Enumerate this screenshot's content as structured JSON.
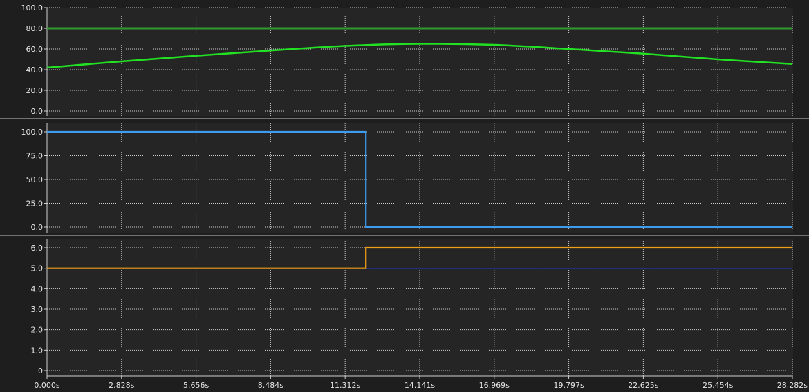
{
  "chart_data": [
    {
      "type": "line",
      "ylim": [
        0,
        100
      ],
      "yticks": [
        "100.0",
        "80.0",
        "60.0",
        "40.0",
        "20.0",
        "0.0"
      ],
      "ytick_values": [
        100,
        80,
        60,
        40,
        20,
        0
      ],
      "series": [
        {
          "color": "#2e9b2e",
          "x": [
            0,
            28.282
          ],
          "values": [
            80,
            80
          ]
        },
        {
          "color": "#22e022",
          "x": [
            0,
            2.828,
            5.656,
            8.484,
            11.312,
            14.141,
            16.969,
            19.797,
            22.625,
            25.454,
            28.282
          ],
          "values": [
            42,
            48,
            53.5,
            58.5,
            63,
            65,
            64,
            60,
            55.5,
            50,
            45.5
          ]
        }
      ]
    },
    {
      "type": "line",
      "ylim": [
        0,
        100
      ],
      "yticks": [
        "100.0",
        "75.0",
        "50.0",
        "25.0",
        "0.0"
      ],
      "ytick_values": [
        100,
        75,
        50,
        25,
        0
      ],
      "series": [
        {
          "color": "#3d9bf0",
          "x": [
            0,
            12.1,
            12.1,
            28.282
          ],
          "values": [
            100,
            100,
            0,
            0
          ]
        }
      ]
    },
    {
      "type": "line",
      "ylim": [
        0,
        6
      ],
      "yticks": [
        "6.0",
        "5.0",
        "4.0",
        "3.0",
        "2.0",
        "1.0",
        "0"
      ],
      "ytick_values": [
        6,
        5,
        4,
        3,
        2,
        1,
        0
      ],
      "series": [
        {
          "color": "#1a3cff",
          "x": [
            0,
            28.282
          ],
          "values": [
            5,
            5
          ]
        },
        {
          "color": "#f0a018",
          "x": [
            0,
            12.1,
            12.1,
            28.282
          ],
          "values": [
            5,
            5,
            6,
            6
          ]
        }
      ]
    }
  ],
  "x_axis": {
    "xlim": [
      0,
      28.282
    ],
    "tick_values": [
      0,
      2.828,
      5.656,
      8.484,
      11.312,
      14.141,
      16.969,
      19.797,
      22.625,
      25.454,
      28.282
    ],
    "tick_labels": [
      "0.000s",
      "2.828s",
      "5.656s",
      "8.484s",
      "11.312s",
      "14.141s",
      "16.969s",
      "19.797s",
      "22.625s",
      "25.454s",
      "28.282s"
    ]
  }
}
